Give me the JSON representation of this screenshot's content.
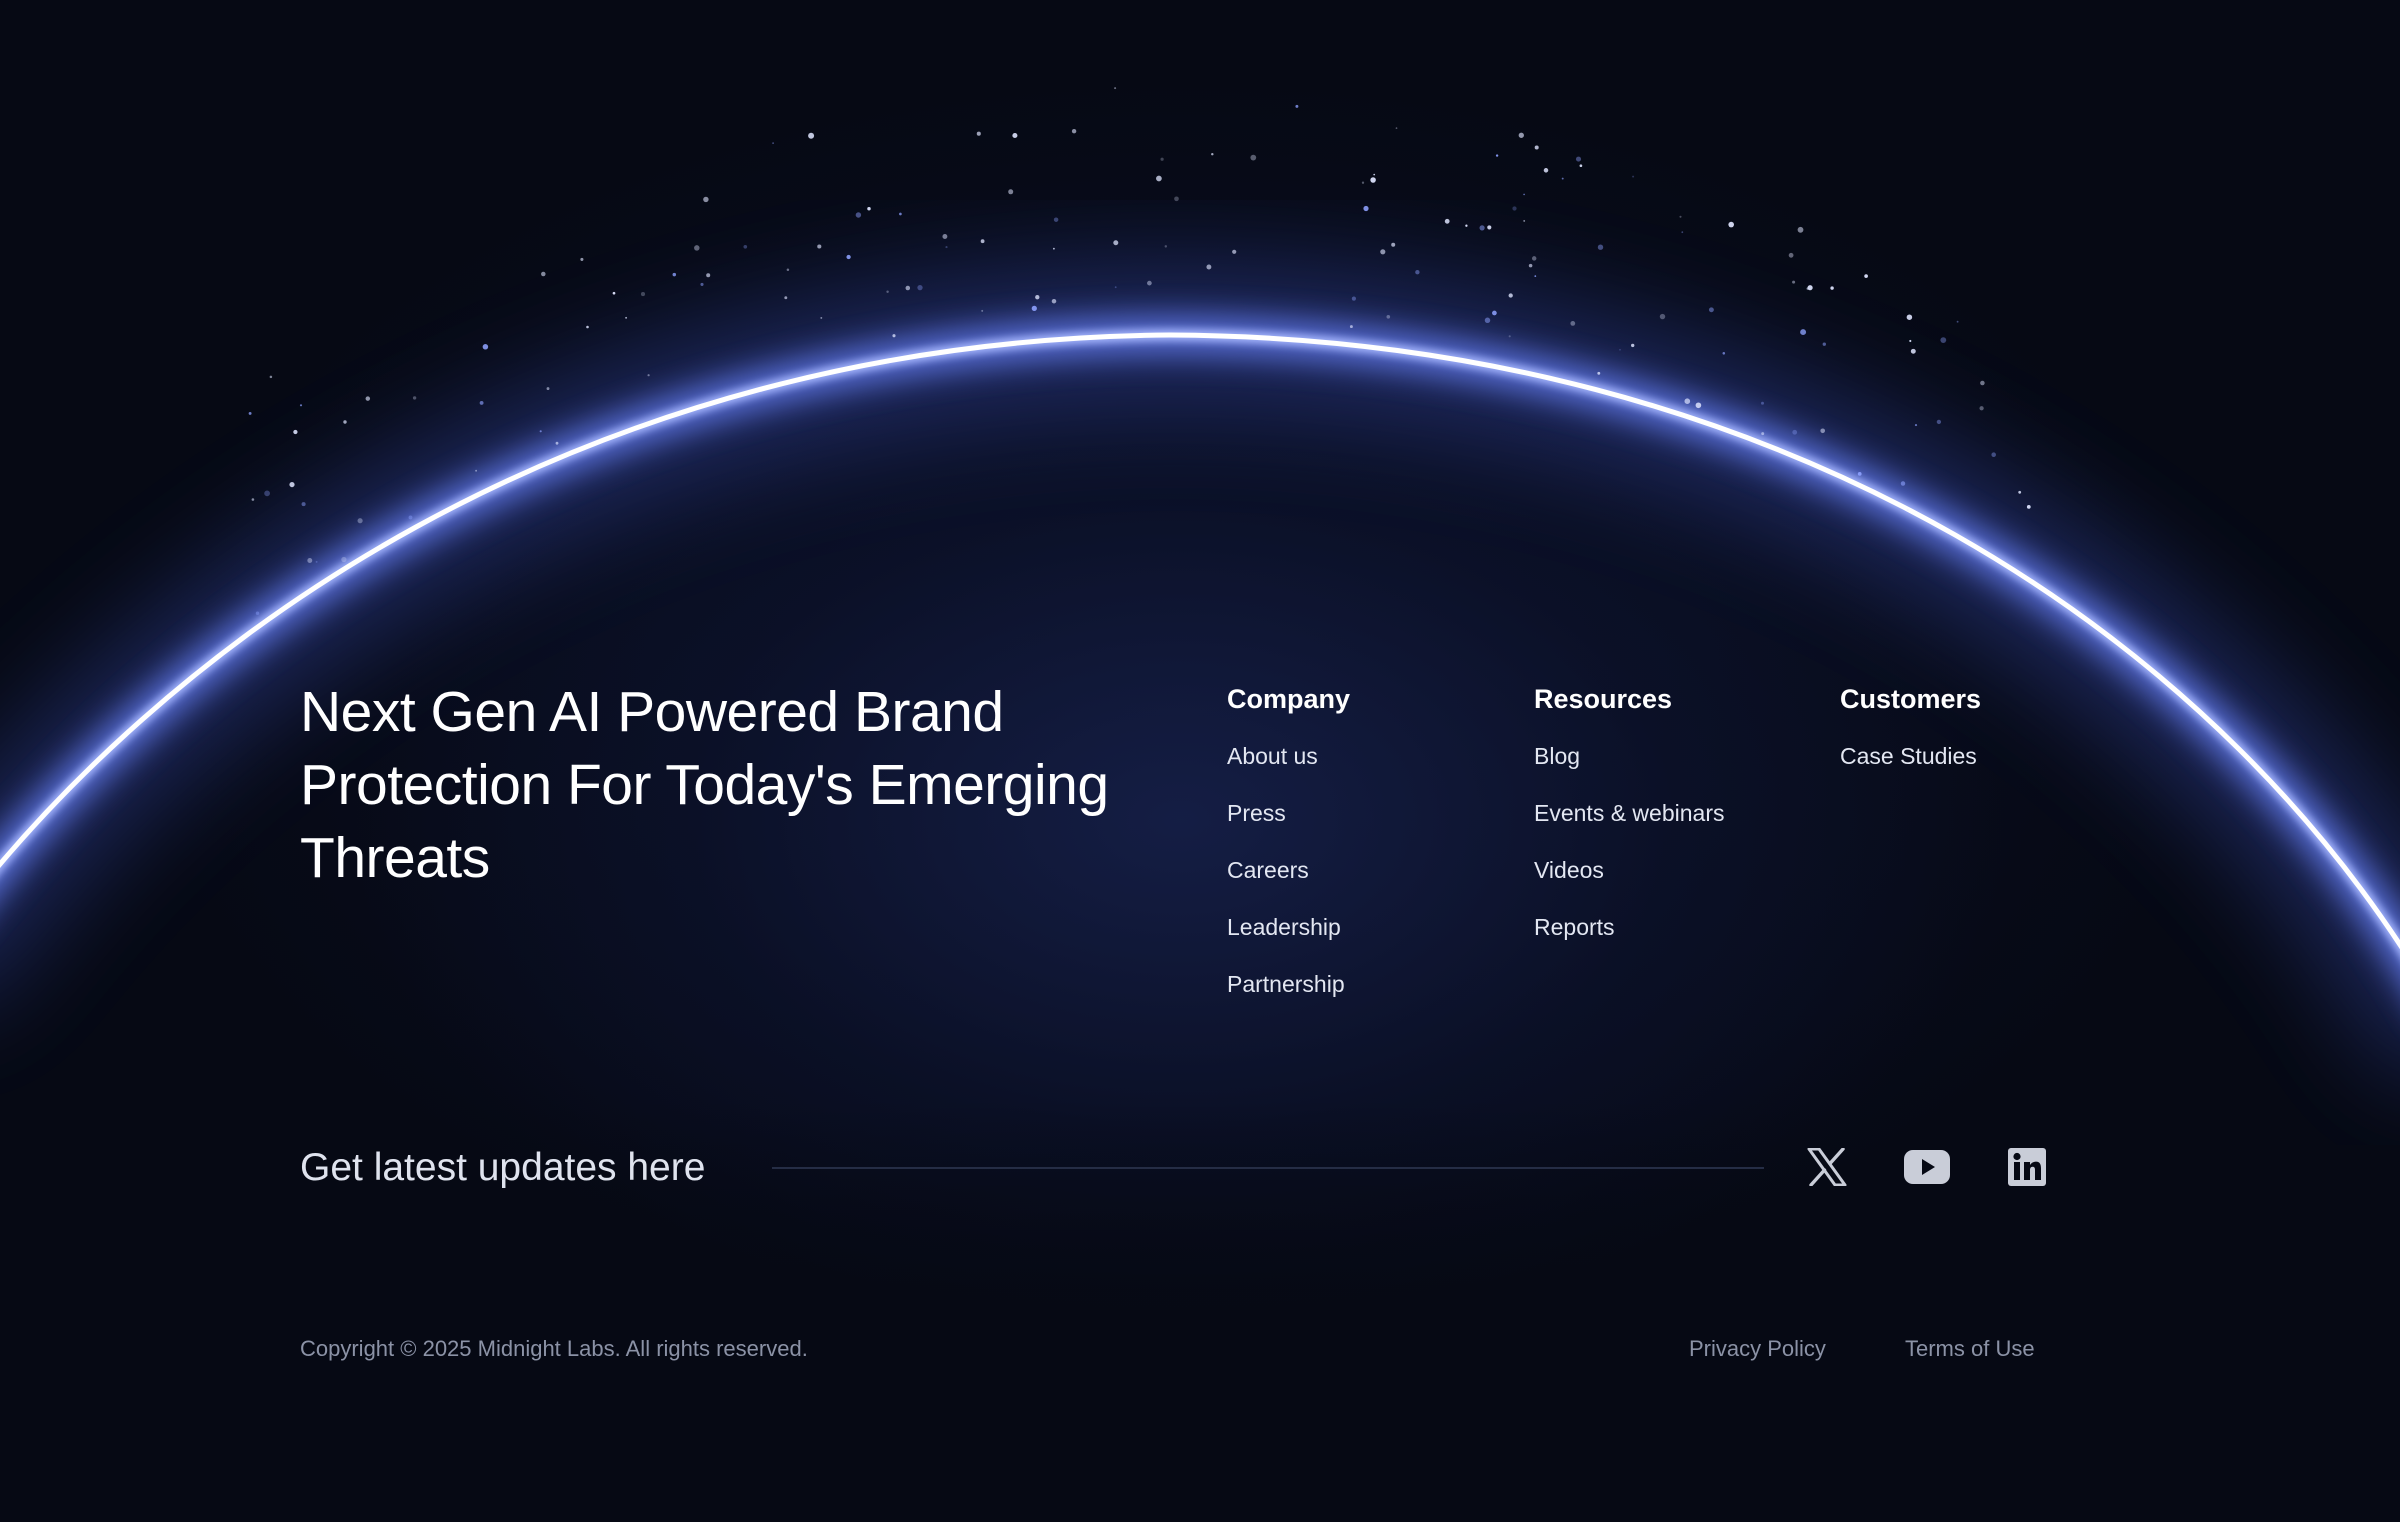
{
  "hero": {
    "headline": "Next Gen AI Powered Brand Protection For Today's Emerging Threats"
  },
  "nav": {
    "company": {
      "title": "Company",
      "links": [
        "About us",
        "Press",
        "Careers",
        "Leadership",
        "Partnership"
      ]
    },
    "resources": {
      "title": "Resources",
      "links": [
        "Blog",
        "Events & webinars",
        "Videos",
        "Reports"
      ]
    },
    "customers": {
      "title": "Customers",
      "links": [
        "Case Studies"
      ]
    }
  },
  "newsletter": {
    "label": "Get latest updates here"
  },
  "social": {
    "icons": [
      "x-icon",
      "youtube-icon",
      "linkedin-icon"
    ]
  },
  "footer": {
    "copyright": "Copyright © 2025 Midnight Labs. All rights reserved.",
    "privacy": "Privacy Policy",
    "terms": "Terms of Use"
  },
  "colors": {
    "background": "#060914",
    "glow": "#6d86ff",
    "text": "#ffffff",
    "muted": "#8b92a6"
  }
}
